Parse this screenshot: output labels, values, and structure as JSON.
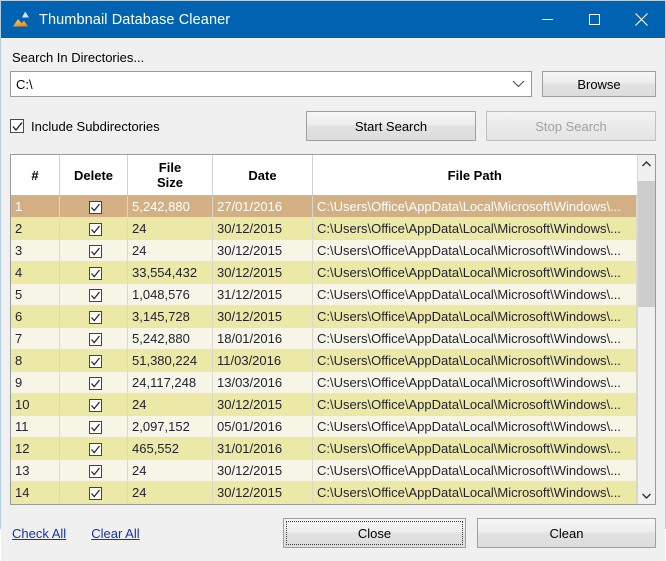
{
  "window": {
    "title": "Thumbnail Database Cleaner",
    "icon": "thumbnail-image-icon",
    "accent_color": "#0063b1",
    "caption": {
      "minimize": "minimize-icon",
      "maximize": "maximize-icon",
      "close": "close-icon"
    }
  },
  "search": {
    "label": "Search In Directories...",
    "directory_value": "C:\\",
    "directory_placeholder": "C:\\",
    "browse_label": "Browse",
    "include_subdirectories_label": "Include Subdirectories",
    "include_subdirectories_checked": true,
    "start_label": "Start Search",
    "stop_label": "Stop Search",
    "stop_enabled": false
  },
  "grid": {
    "columns": [
      "#",
      "Delete",
      "File\nSize",
      "Date",
      "File Path"
    ],
    "columns_flat": {
      "num": "#",
      "delete": "Delete",
      "size_line1": "File",
      "size_line2": "Size",
      "date": "Date",
      "path": "File Path"
    },
    "selected_row": 1,
    "colors": {
      "selected": "#d2b083",
      "odd_row": "#ece9a7",
      "even_row": "#f7f6e6"
    },
    "rows": [
      {
        "num": "1",
        "checked": true,
        "size": "5,242,880",
        "date": "27/01/2016",
        "path": "C:\\Users\\Office\\AppData\\Local\\Microsoft\\Windows\\..."
      },
      {
        "num": "2",
        "checked": true,
        "size": "24",
        "date": "30/12/2015",
        "path": "C:\\Users\\Office\\AppData\\Local\\Microsoft\\Windows\\..."
      },
      {
        "num": "3",
        "checked": true,
        "size": "24",
        "date": "30/12/2015",
        "path": "C:\\Users\\Office\\AppData\\Local\\Microsoft\\Windows\\..."
      },
      {
        "num": "4",
        "checked": true,
        "size": "33,554,432",
        "date": "30/12/2015",
        "path": "C:\\Users\\Office\\AppData\\Local\\Microsoft\\Windows\\..."
      },
      {
        "num": "5",
        "checked": true,
        "size": "1,048,576",
        "date": "31/12/2015",
        "path": "C:\\Users\\Office\\AppData\\Local\\Microsoft\\Windows\\..."
      },
      {
        "num": "6",
        "checked": true,
        "size": "3,145,728",
        "date": "30/12/2015",
        "path": "C:\\Users\\Office\\AppData\\Local\\Microsoft\\Windows\\..."
      },
      {
        "num": "7",
        "checked": true,
        "size": "5,242,880",
        "date": "18/01/2016",
        "path": "C:\\Users\\Office\\AppData\\Local\\Microsoft\\Windows\\..."
      },
      {
        "num": "8",
        "checked": true,
        "size": "51,380,224",
        "date": "11/03/2016",
        "path": "C:\\Users\\Office\\AppData\\Local\\Microsoft\\Windows\\..."
      },
      {
        "num": "9",
        "checked": true,
        "size": "24,117,248",
        "date": "13/03/2016",
        "path": "C:\\Users\\Office\\AppData\\Local\\Microsoft\\Windows\\..."
      },
      {
        "num": "10",
        "checked": true,
        "size": "24",
        "date": "30/12/2015",
        "path": "C:\\Users\\Office\\AppData\\Local\\Microsoft\\Windows\\..."
      },
      {
        "num": "11",
        "checked": true,
        "size": "2,097,152",
        "date": "05/01/2016",
        "path": "C:\\Users\\Office\\AppData\\Local\\Microsoft\\Windows\\..."
      },
      {
        "num": "12",
        "checked": true,
        "size": "465,552",
        "date": "31/01/2016",
        "path": "C:\\Users\\Office\\AppData\\Local\\Microsoft\\Windows\\..."
      },
      {
        "num": "13",
        "checked": true,
        "size": "24",
        "date": "30/12/2015",
        "path": "C:\\Users\\Office\\AppData\\Local\\Microsoft\\Windows\\..."
      },
      {
        "num": "14",
        "checked": true,
        "size": "24",
        "date": "30/12/2015",
        "path": "C:\\Users\\Office\\AppData\\Local\\Microsoft\\Windows\\..."
      }
    ],
    "scrollbar": {
      "up_icon": "chevron-up-icon",
      "down_icon": "chevron-down-icon",
      "thumb_top_pct": 3,
      "thumb_height_pct": 40
    }
  },
  "footer": {
    "check_all": "Check All",
    "clear_all": "Clear All",
    "close_label": "Close",
    "clean_label": "Clean",
    "link_color": "#0f35a8"
  }
}
